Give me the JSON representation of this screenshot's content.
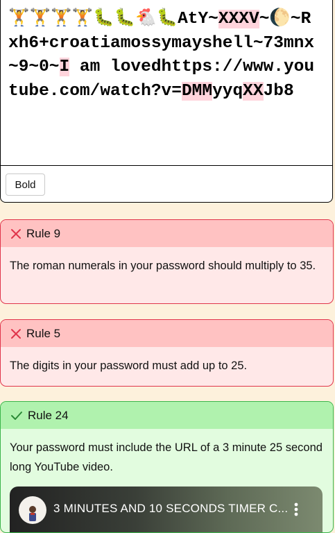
{
  "password": {
    "emoji_weightlifters": "🏋️🏋️🏋️🏋️",
    "emoji_worms_1": "🐛🐛",
    "emoji_chicken": "🐔",
    "emoji_worms_2": "🐛",
    "seg_1": "AtY~",
    "roman_1": "XXXV",
    "seg_2": "~",
    "emoji_moon": "🌔",
    "seg_3": "~Rxh6+croatiamossymayshell~73mnx~9~0~",
    "roman_2": "I",
    "seg_4": " am lovedhttps://www.youtube.com/watch?v=",
    "roman_3": "DMM",
    "seg_5": "yyq",
    "roman_4": "XX",
    "seg_6": "Jb8"
  },
  "toolbar": {
    "bold_label": "Bold"
  },
  "rules": [
    {
      "status": "fail",
      "icon": "x-icon",
      "title": "Rule 9",
      "description": "The roman numerals in your password should multiply to 35."
    },
    {
      "status": "fail",
      "icon": "x-icon",
      "title": "Rule 5",
      "description": "The digits in your password must add up to 25."
    },
    {
      "status": "pass",
      "icon": "check-icon",
      "title": "Rule 24",
      "description": "Your password must include the URL of a 3 minute 25 second long YouTube video.",
      "video_title": "3 MINUTES AND 10 SECONDS TIMER C..."
    }
  ],
  "colors": {
    "fail_border": "#e0344a",
    "fail_header": "#ffc2c2",
    "fail_body": "#ffe8e8",
    "pass_border": "#3bb54a",
    "pass_header": "#b0f2ae",
    "pass_body": "#e2fcdf",
    "roman_highlight": "#ffd4dc"
  }
}
